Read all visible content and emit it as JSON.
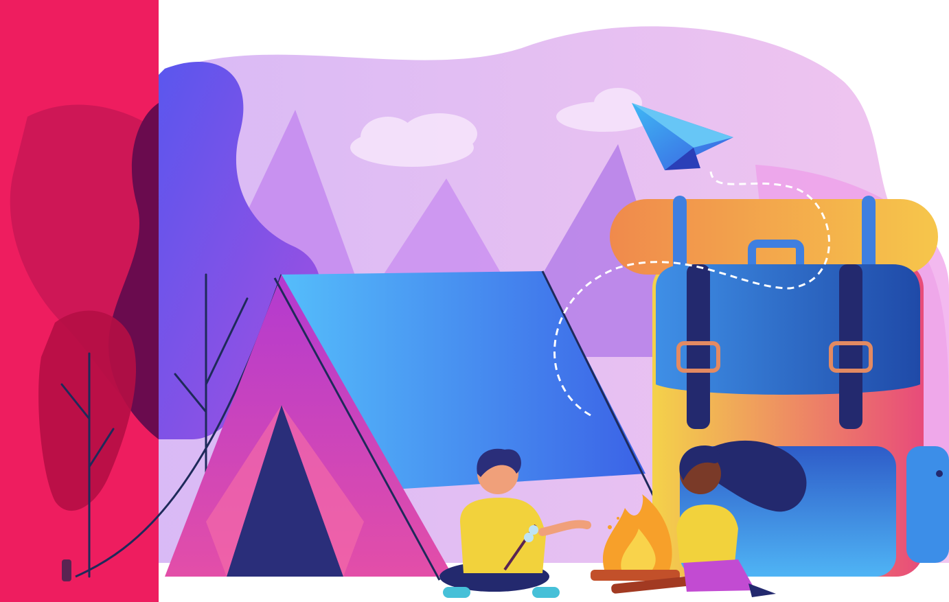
{
  "scene": {
    "description_label": "",
    "colors": {
      "sidebar": "#ee1d5f",
      "blob_back": "#e9b8f0",
      "blob_mountain": "#b07be8",
      "tree_purple": "#6a4ee8",
      "tent_fly": "#4fa8f5",
      "tent_body": "#c24bd2",
      "backpack_top": "#f2b94b",
      "backpack_body": "#2e5fb8",
      "fire": "#f7a02a",
      "outline": "#1e2a5a"
    },
    "icons": [
      "paper-plane-icon",
      "tent-icon",
      "backpack-icon",
      "campfire-icon",
      "child-boy-icon",
      "child-girl-icon",
      "tree-icon",
      "mountain-icon",
      "cloud-icon"
    ]
  }
}
